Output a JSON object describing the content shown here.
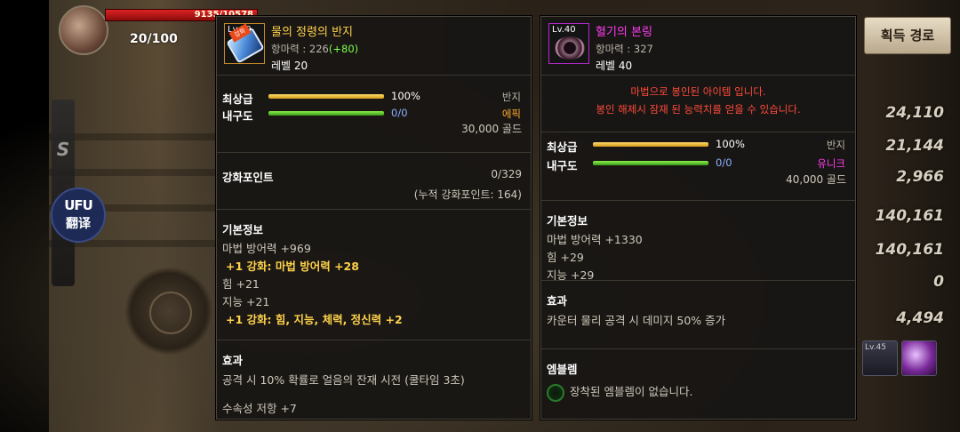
{
  "hud": {
    "hp_text": "9135/10578",
    "mp_text": "20/100"
  },
  "sidebar": {
    "tab_letter": "S",
    "translate_logo": "UFU",
    "translate_label": "翻译"
  },
  "acquire_button": "획득 경로",
  "stats_values": [
    "24,110",
    "21,144",
    "2,966",
    "140,161",
    "140,161",
    "0",
    "4,494"
  ],
  "skill_icon_label": "Lv.45",
  "left_item": {
    "level_badge": "Lv.20",
    "corner_badge": "강화",
    "name": "물의 정령의 반지",
    "magic_resist_label": "항마력 : 226",
    "magic_resist_bonus": "(+80)",
    "level": "레벨 20",
    "top_grade_label": "최상급",
    "top_grade_pct": "100%",
    "top_grade_fill": 1.0,
    "type": "반지",
    "durability_label": "내구도",
    "durability_value": "0/0",
    "durability_fill": 1.0,
    "rarity": "에픽",
    "price": "30,000 골드",
    "enhance_title": "강화포인트",
    "enhance_value": "0/329",
    "enhance_cumulative": "(누적 강화포인트: 164)",
    "basic_info_title": "기본정보",
    "basic_lines": [
      "마법 방어력 +969",
      "+1 강화: 마법 방어력 +28",
      "힘 +21",
      "지능 +21",
      "+1 강화: 힘, 지능, 체력, 정신력 +2"
    ],
    "effect_title": "효과",
    "effect_text": "공격 시 10% 확률로 얼음의 잔재 시전 (쿨타임 3초)",
    "extra_line": "수속성 저항 +7"
  },
  "right_item": {
    "level_badge": "Lv.40",
    "name": "혈기의 본링",
    "magic_resist_label": "항마력 : 327",
    "level": "레벨 40",
    "sealed_line1": "마법으로 봉인된 아이템 입니다.",
    "sealed_line2": "봉인 해제시 잠재 된 능력치를 얻을 수 있습니다.",
    "top_grade_label": "최상급",
    "top_grade_pct": "100%",
    "top_grade_fill": 1.0,
    "type": "반지",
    "durability_label": "내구도",
    "durability_value": "0/0",
    "durability_fill": 1.0,
    "rarity": "유니크",
    "price": "40,000 골드",
    "basic_info_title": "기본정보",
    "basic_lines": [
      "마법 방어력 +1330",
      "힘 +29",
      "지능 +29"
    ],
    "effect_title": "효과",
    "effect_text": "카운터 물리 공격 시 데미지 50% 증가",
    "emblem_title": "엠블렘",
    "emblem_text": "장착된 엠블렘이 없습니다."
  }
}
